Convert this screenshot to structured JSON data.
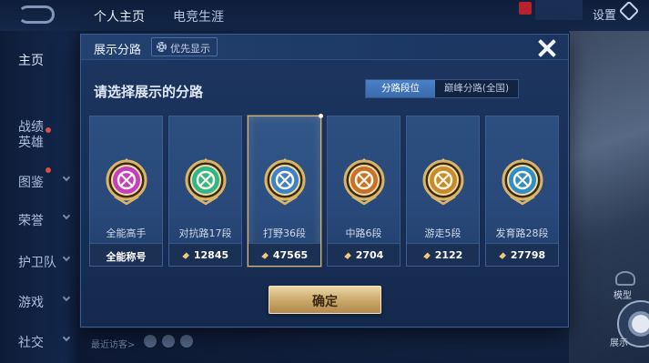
{
  "header": {
    "tabs": [
      "个人主页",
      "电竞生涯"
    ],
    "settings_label": "设置"
  },
  "sidebar": {
    "items": [
      "主页",
      "战绩",
      "英雄",
      "图鉴",
      "荣誉",
      "护卫队",
      "游戏",
      "社交"
    ]
  },
  "footer": {
    "visitors_label": "最近访客>"
  },
  "right_panel": {
    "mode_label": "模型",
    "action_label": "展示"
  },
  "modal": {
    "title": "展示分路",
    "priority_label": "优先显示",
    "prompt": "请选择展示的分路",
    "toggle": [
      {
        "label": "分路段位",
        "selected": true
      },
      {
        "label": "巅峰分路(全国)",
        "selected": false
      }
    ],
    "cards": [
      {
        "label": "全能高手",
        "value": "全能称号",
        "show_icon": false,
        "color": "#c23fc0",
        "selected": false
      },
      {
        "label": "对抗路17段",
        "value": "12845",
        "show_icon": true,
        "color": "#2fb68a",
        "selected": false
      },
      {
        "label": "打野36段",
        "value": "47565",
        "show_icon": true,
        "color": "#3b82c8",
        "selected": true
      },
      {
        "label": "中路6段",
        "value": "2704",
        "show_icon": true,
        "color": "#c8712e",
        "selected": false
      },
      {
        "label": "游走5段",
        "value": "2122",
        "show_icon": true,
        "color": "#c88a2e",
        "selected": false
      },
      {
        "label": "发育路28段",
        "value": "27798",
        "show_icon": true,
        "color": "#2e8ec8",
        "selected": false
      }
    ],
    "confirm_label": "确定"
  },
  "colors": {
    "accent_gold": "#d7b878",
    "toggle_selected": "#3a6bad"
  }
}
